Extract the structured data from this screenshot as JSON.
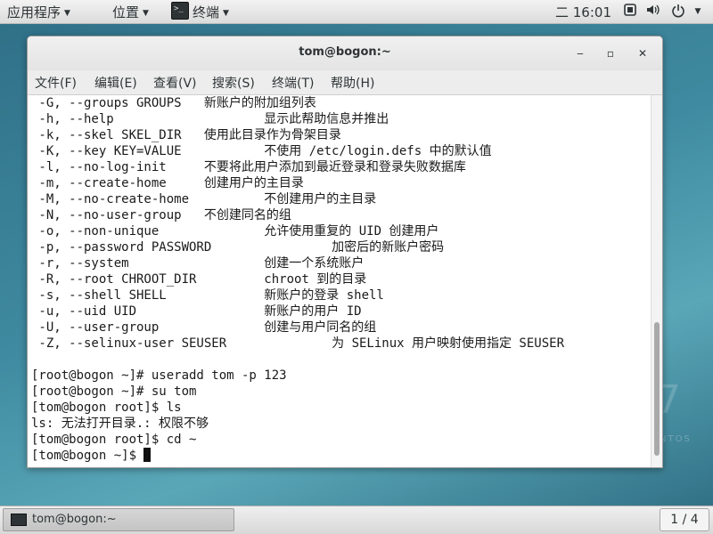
{
  "top_panel": {
    "applications": "应用程序",
    "places": "位置",
    "terminal_app": "终端",
    "clock": "二 16:01"
  },
  "desktop": {
    "watermark_number": "7",
    "watermark_text": "NTOS"
  },
  "window": {
    "title": "tom@bogon:~",
    "minimize_glyph": "‒",
    "maximize_glyph": "▫",
    "close_glyph": "✕"
  },
  "menubar": [
    "文件(F)",
    "编辑(E)",
    "查看(V)",
    "搜索(S)",
    "终端(T)",
    "帮助(H)"
  ],
  "terminal_lines": [
    " -G, --groups GROUPS   新账户的附加组列表",
    " -h, --help                    显示此帮助信息并推出",
    " -k, --skel SKEL_DIR   使用此目录作为骨架目录",
    " -K, --key KEY=VALUE           不使用 /etc/login.defs 中的默认值",
    " -l, --no-log-init     不要将此用户添加到最近登录和登录失败数据库",
    " -m, --create-home     创建用户的主目录",
    " -M, --no-create-home          不创建用户的主目录",
    " -N, --no-user-group   不创建同名的组",
    " -o, --non-unique              允许使用重复的 UID 创建用户",
    " -p, --password PASSWORD                加密后的新账户密码",
    " -r, --system                  创建一个系统账户",
    " -R, --root CHROOT_DIR         chroot 到的目录",
    " -s, --shell SHELL             新账户的登录 shell",
    " -u, --uid UID                 新账户的用户 ID",
    " -U, --user-group              创建与用户同名的组",
    " -Z, --selinux-user SEUSER              为 SELinux 用户映射使用指定 SEUSER",
    "",
    "[root@bogon ~]# useradd tom -p 123",
    "[root@bogon ~]# su tom",
    "[tom@bogon root]$ ls",
    "ls: 无法打开目录.: 权限不够",
    "[tom@bogon root]$ cd ~",
    "[tom@bogon ~]$ "
  ],
  "taskbar": {
    "task_label": "tom@bogon:~",
    "workspace": "1 / 4"
  }
}
